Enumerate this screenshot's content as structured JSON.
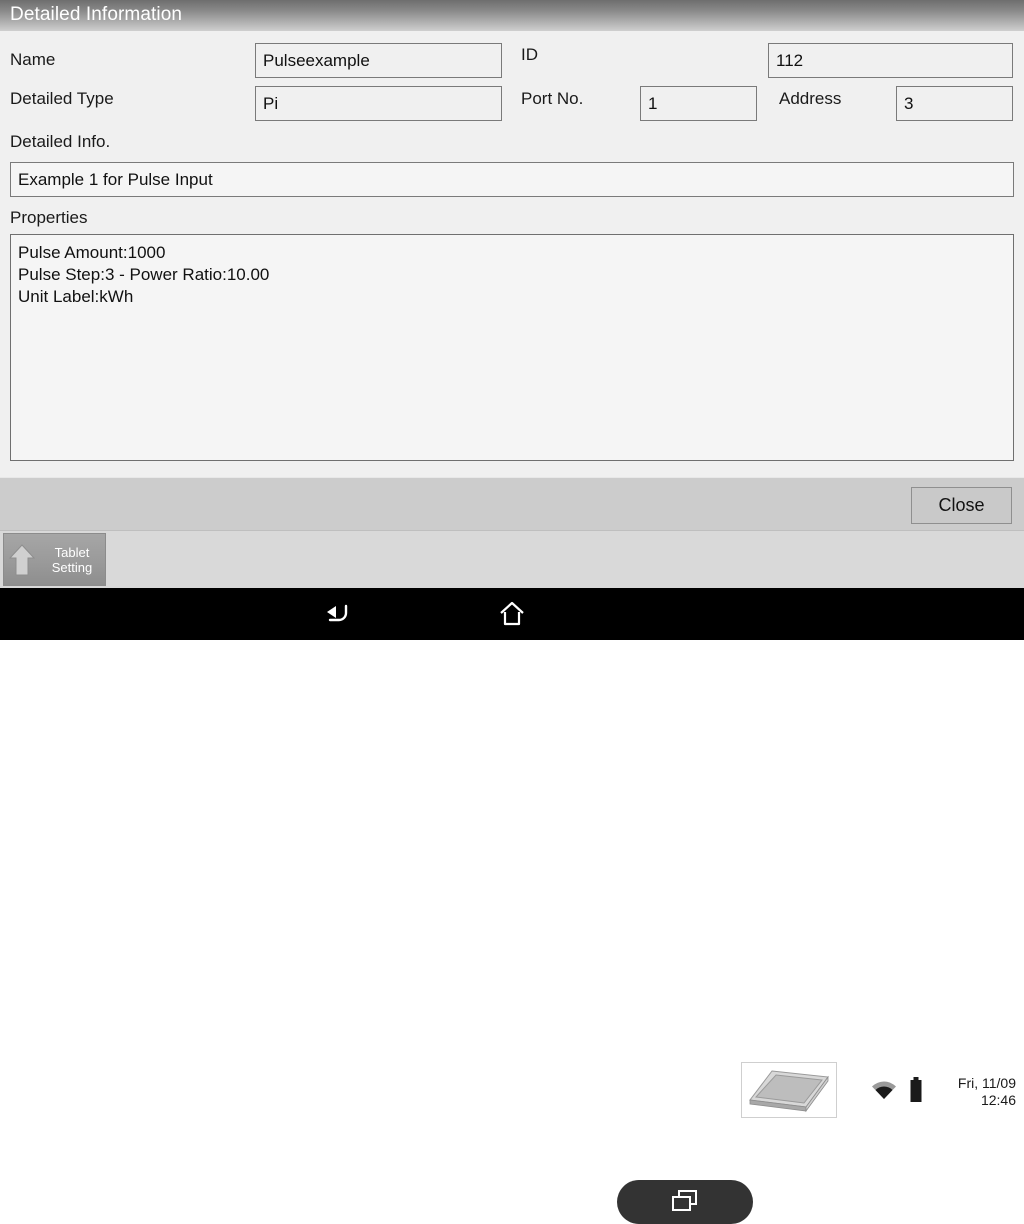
{
  "window": {
    "title": "Detailed Information"
  },
  "form": {
    "name_label": "Name",
    "name_value": "Pulseexample",
    "id_label": "ID",
    "id_value": "112",
    "detailed_type_label": "Detailed Type",
    "detailed_type_value": "Pi",
    "port_no_label": "Port No.",
    "port_no_value": "1",
    "address_label": "Address",
    "address_value": "3",
    "detailed_info_label": "Detailed Info.",
    "detailed_info_value": "Example 1 for Pulse Input",
    "properties_label": "Properties",
    "properties_value": "Pulse Amount:1000\nPulse Step:3 - Power Ratio:10.00\nUnit Label:kWh"
  },
  "buttons": {
    "close_label": "Close"
  },
  "taskbar": {
    "tablet_setting_line1": "Tablet",
    "tablet_setting_line2": "Setting",
    "clock_date": "Fri, 11/09",
    "clock_time": "12:46",
    "wifi_icon": "wifi-icon",
    "battery_icon": "battery-icon",
    "tray_icon": "tablet-device-icon"
  },
  "navbar": {
    "back_icon": "back-arrow-icon",
    "home_icon": "home-icon",
    "recents_icon": "recent-apps-icon"
  },
  "colors": {
    "window_background": "#f0f0f0",
    "titlebar_text": "#ffffff",
    "button_bar": "#cccccc",
    "taskbar": "#d9d9d9",
    "navbar": "#000000",
    "field_border": "#7a7a7a"
  }
}
